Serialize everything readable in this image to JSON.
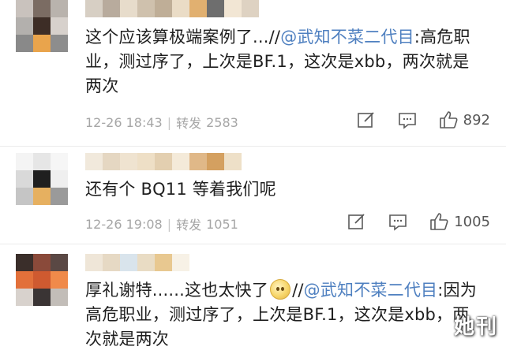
{
  "comments": [
    {
      "text_before": "这个应该算极端案例了...//",
      "mention": "@武知不菜二代目",
      "text_after": ":高危职业，测过序了，上次是BF.1，这次是xbb，两次就是两次",
      "time": "12-26 18:43",
      "repost_label": "转发",
      "repost_count": "2583",
      "like_count": "892"
    },
    {
      "text_before": "还有个 BQ11 等着我们呢",
      "time": "12-26 19:08",
      "repost_label": "转发",
      "repost_count": "1051",
      "like_count": "1005"
    },
    {
      "text_before": "厚礼谢特......这也太快了",
      "text_middle": "//",
      "mention": "@武知不菜二代目",
      "text_after": ":因为高危职业，测过序了，上次是BF.1，这次是xbb，两次就是两次"
    }
  ],
  "icons": {
    "edit": "edit-icon",
    "comment": "comment-icon",
    "like": "thumbs-up-icon"
  },
  "colors": {
    "mention": "#4f80c0",
    "meta": "#a6a6a6"
  },
  "watermark": "她刊"
}
